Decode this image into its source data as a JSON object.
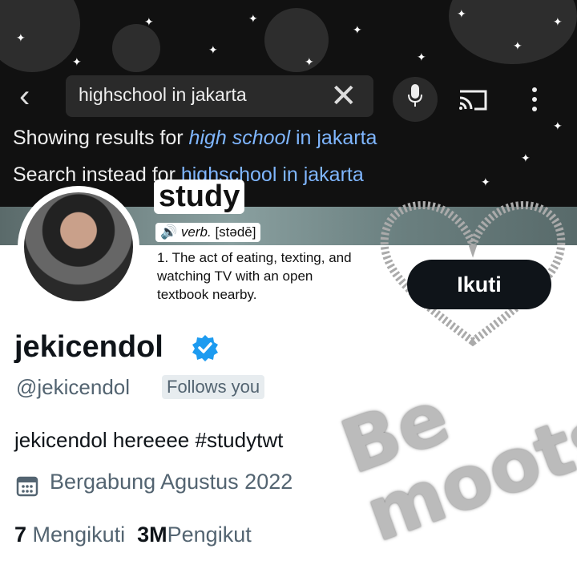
{
  "search": {
    "query": "highschool in jakarta"
  },
  "results": {
    "showing_prefix": "Showing results for ",
    "showing_italic": "high school",
    "showing_suffix": " in jakarta",
    "instead_prefix": "Search instead for ",
    "instead_link": "highschool in jakarta"
  },
  "sticker": {
    "word": "study",
    "pos": "verb.",
    "pronunciation": "[stədē]",
    "definition": "1. The act of eating, texting, and watching TV with an open textbook nearby.",
    "bemoots": "Be moots"
  },
  "profile": {
    "follow_label": "Ikuti",
    "name": "jekicendol",
    "handle": "@jekicendol",
    "follows_you": "Follows you",
    "bio": "jekicendol hereeee #studytwt",
    "joined": "Bergabung Agustus 2022",
    "following_count": "7",
    "following_label": "Mengikuti",
    "followers_count": "3M",
    "followers_label": "Pengikut"
  },
  "colors": {
    "link": "#7fb6ff",
    "verified": "#1d9bf0",
    "button_bg": "#0f1419"
  },
  "icons": [
    "back-icon",
    "clear-icon",
    "mic-icon",
    "cast-icon",
    "more-icon",
    "verified-icon",
    "calendar-icon",
    "speaker-icon"
  ]
}
